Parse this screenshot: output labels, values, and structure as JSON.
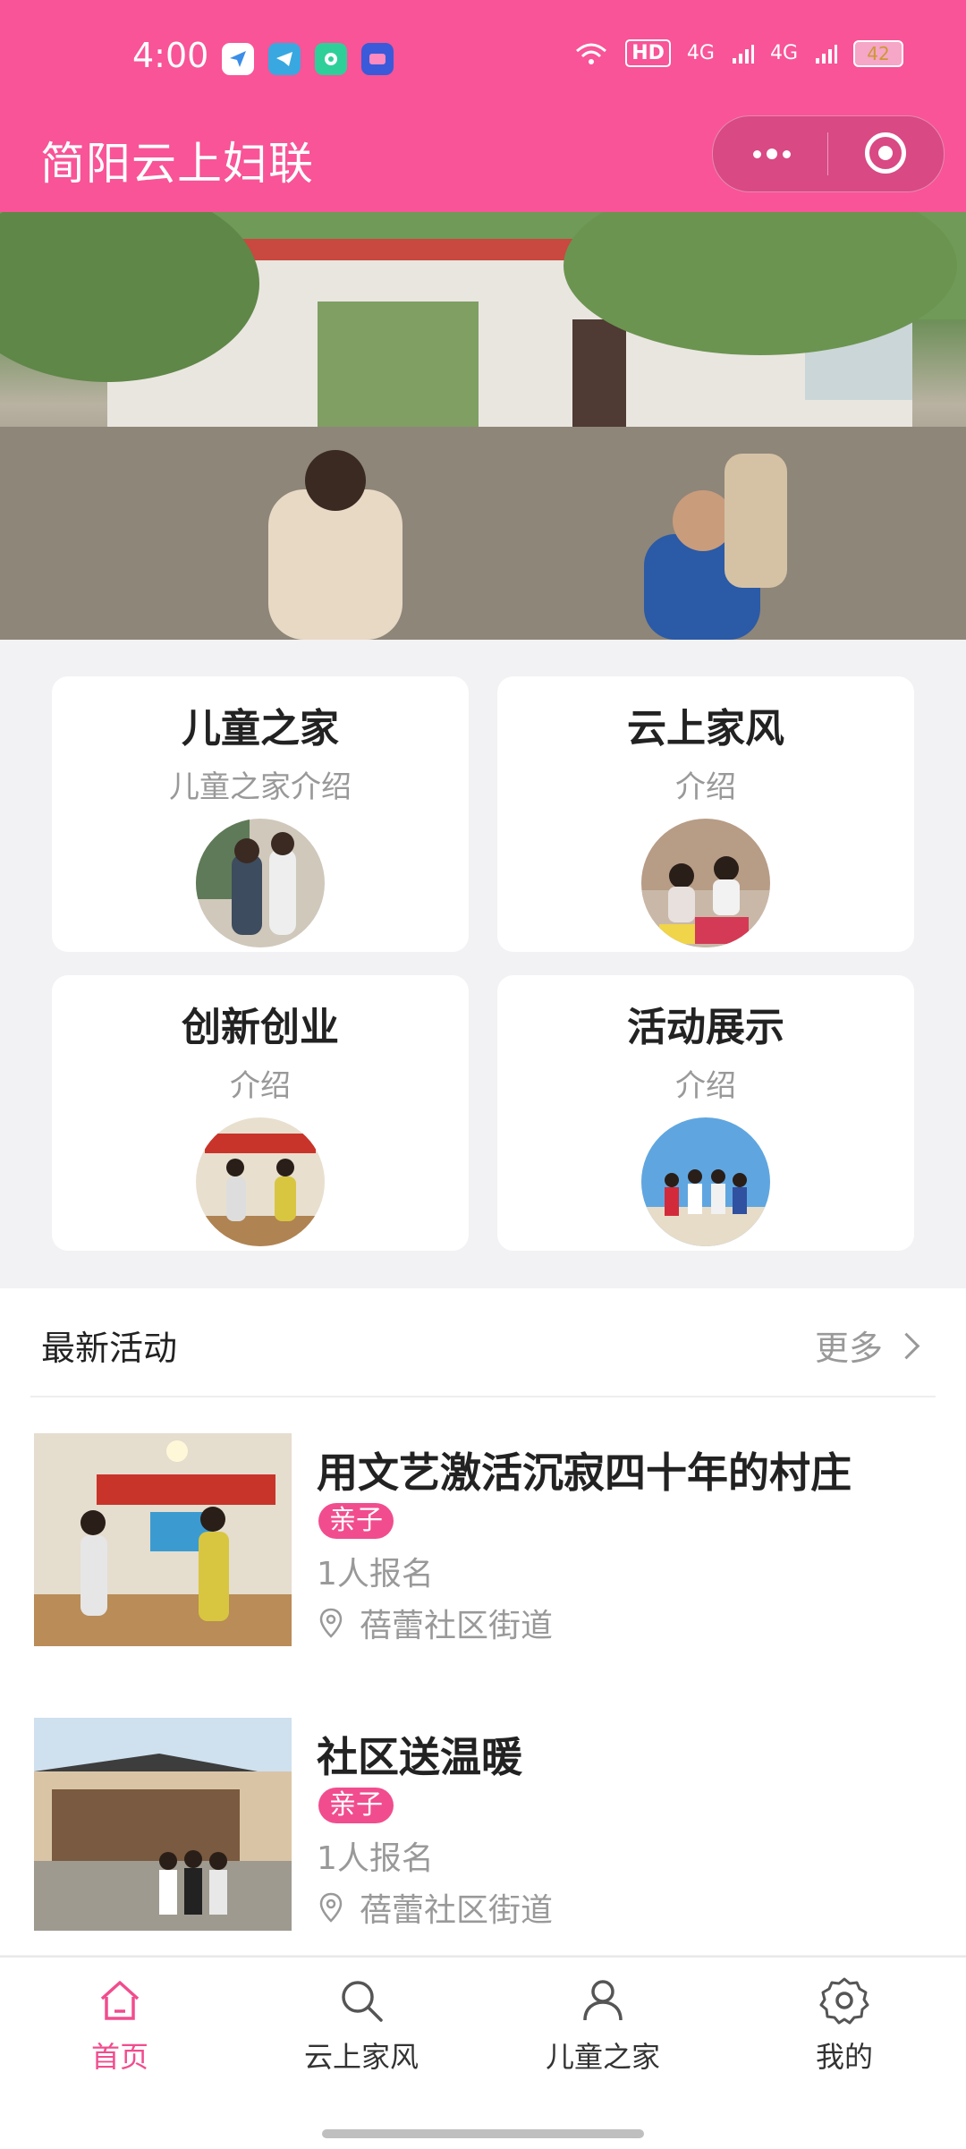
{
  "status_bar": {
    "time": "4:00",
    "hd_label": "HD",
    "battery": "42",
    "network_1": "4G",
    "network_2": "4G"
  },
  "header": {
    "title": "简阳云上妇联"
  },
  "cards": [
    {
      "title": "儿童之家",
      "subtitle": "儿童之家介绍"
    },
    {
      "title": "云上家风",
      "subtitle": "介绍"
    },
    {
      "title": "创新创业",
      "subtitle": "介绍"
    },
    {
      "title": "活动展示",
      "subtitle": "介绍"
    }
  ],
  "latest": {
    "heading": "最新活动",
    "more_label": "更多",
    "activities": [
      {
        "title": "用文艺激活沉寂四十年的村庄",
        "tag": "亲子",
        "signup": "1人报名",
        "location": "蓓蕾社区街道"
      },
      {
        "title": "社区送温暖",
        "tag": "亲子",
        "signup": "1人报名",
        "location": "蓓蕾社区街道"
      }
    ]
  },
  "tabs": [
    {
      "label": "首页",
      "icon": "home-icon",
      "active": true
    },
    {
      "label": "云上家风",
      "icon": "search-icon",
      "active": false
    },
    {
      "label": "儿童之家",
      "icon": "user-icon",
      "active": false
    },
    {
      "label": "我的",
      "icon": "gear-icon",
      "active": false
    }
  ],
  "colors": {
    "brand": "#f85497",
    "tag": "#f14d8e",
    "muted": "#999999"
  }
}
